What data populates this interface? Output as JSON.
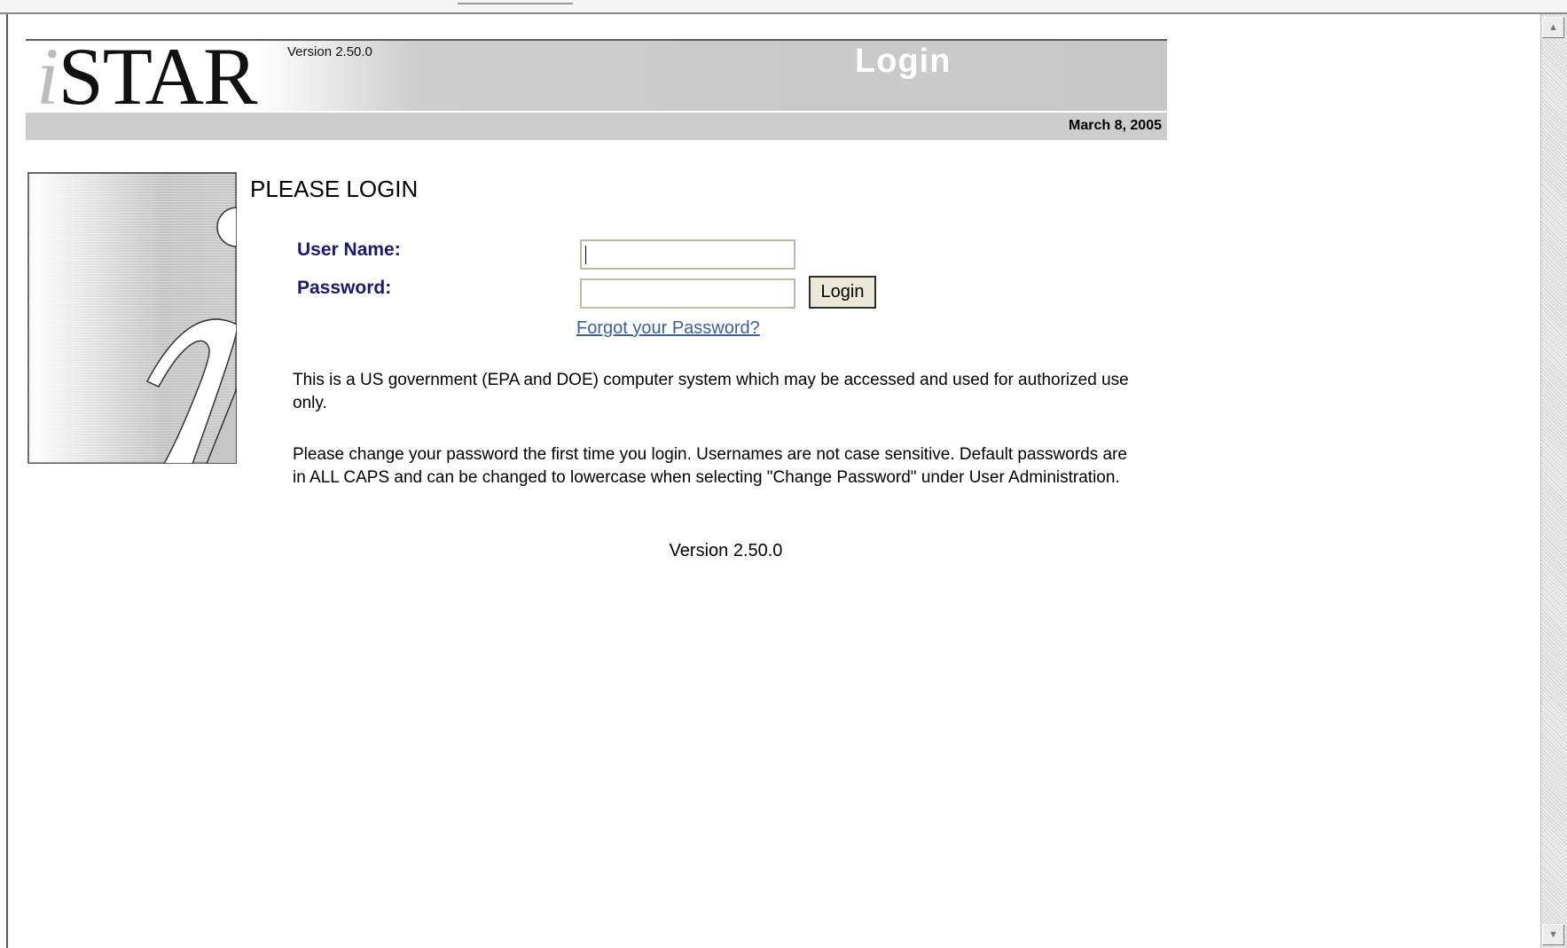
{
  "header": {
    "logo_i": "i",
    "logo_rest": "STAR",
    "version_label": "Version 2.50.0",
    "title": "Login",
    "date": "March 8, 2005"
  },
  "login": {
    "heading": "PLEASE LOGIN",
    "username_label": "User Name:",
    "username_value": "",
    "password_label": "Password:",
    "password_value": "",
    "login_button": "Login",
    "forgot_link": "Forgot your Password?"
  },
  "notices": {
    "p1": "This is a US government (EPA and DOE) computer system which may be accessed and used for authorized use only.",
    "p2": "Please change your password the first time you login. Usernames are not case sensitive. Default passwords are in ALL CAPS and can be changed to lowercase when selecting \"Change Password\" under User Administration."
  },
  "footer": {
    "version": "Version 2.50.0"
  },
  "scrollbar": {
    "up_icon": "scroll-up-arrow",
    "down_icon": "scroll-down-arrow"
  },
  "colors": {
    "label_navy": "#1a1a6e",
    "link_blue": "#3b5ea4",
    "banner_gray": "#cdcdcd",
    "button_face": "#ece9d8"
  }
}
